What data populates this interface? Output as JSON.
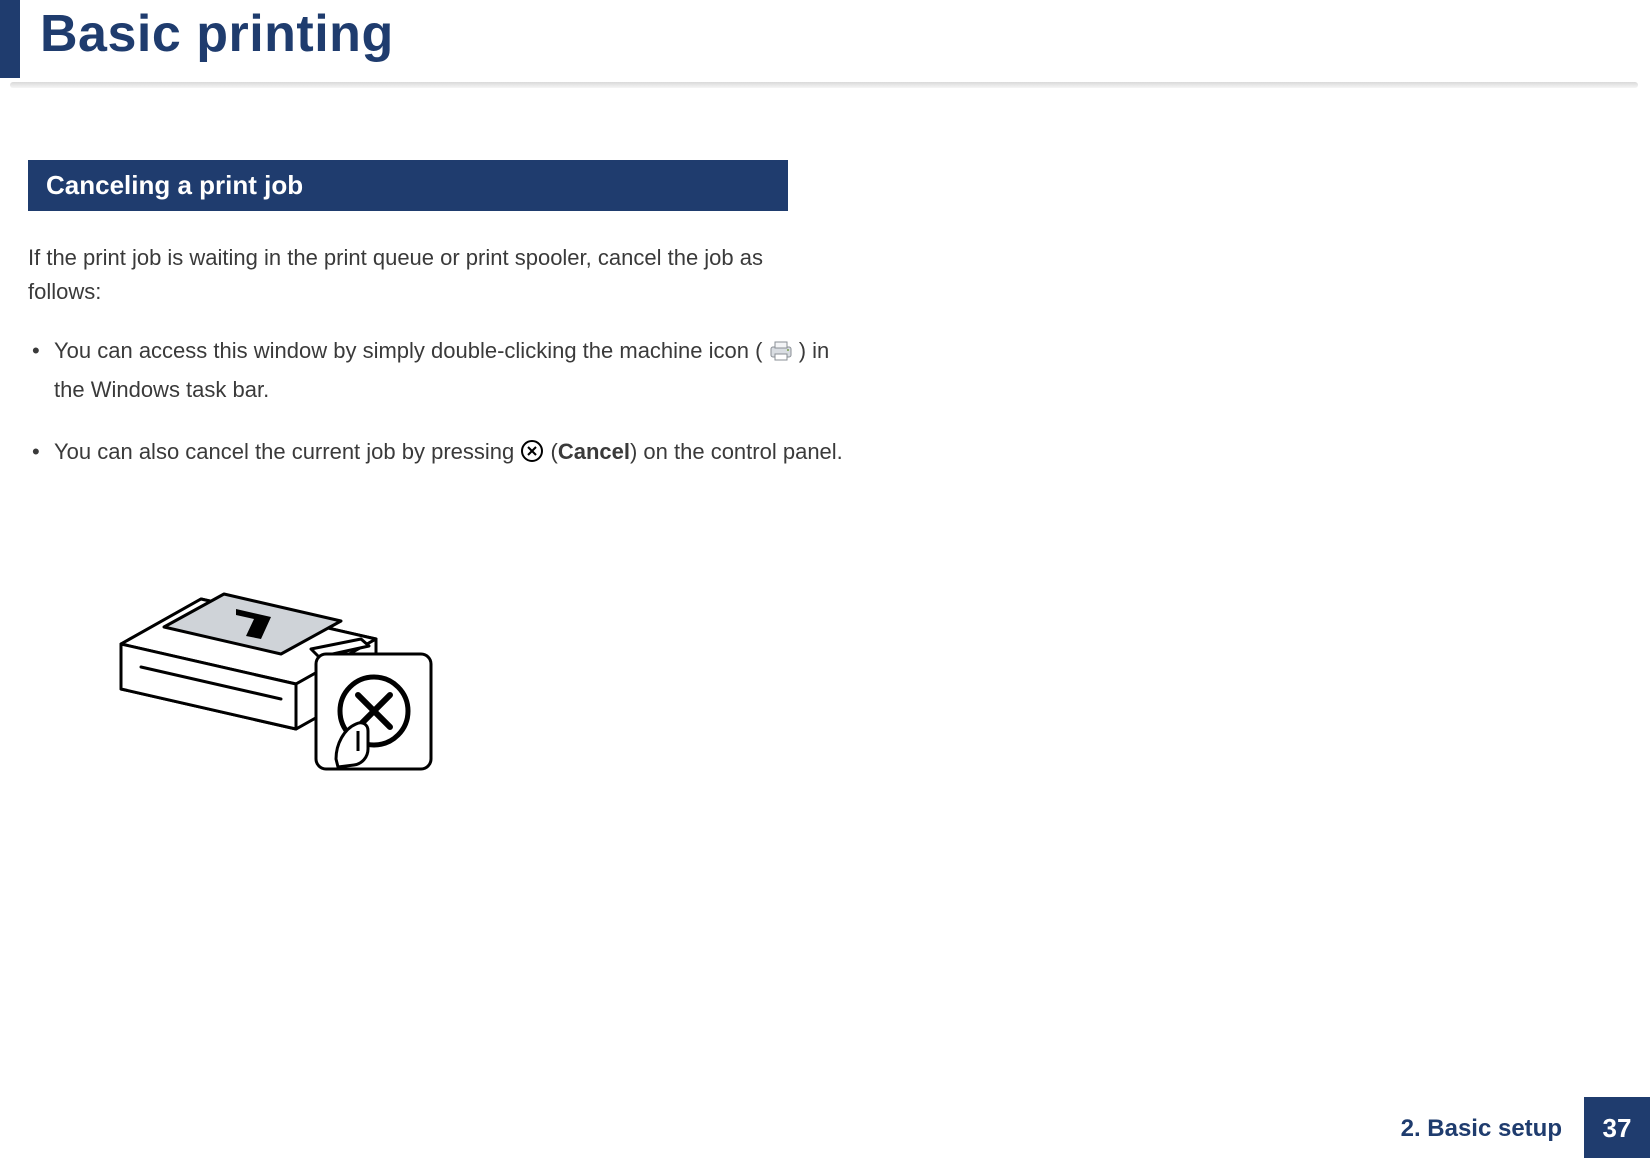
{
  "header": {
    "title": "Basic printing"
  },
  "section": {
    "heading": "Canceling a print job",
    "intro": "If the print job is waiting in the print queue or print spooler, cancel the job as follows:",
    "bullets": {
      "b1_pre": "You can access this window by simply double-clicking the machine icon (",
      "b1_post": ") in the Windows task bar.",
      "b2_pre": "You can also cancel the current job by pressing ",
      "b2_paren_open": " (",
      "b2_bold": "Cancel",
      "b2_paren_close": ") on the control panel."
    }
  },
  "footer": {
    "chapter": "2. Basic setup",
    "page": "37"
  }
}
